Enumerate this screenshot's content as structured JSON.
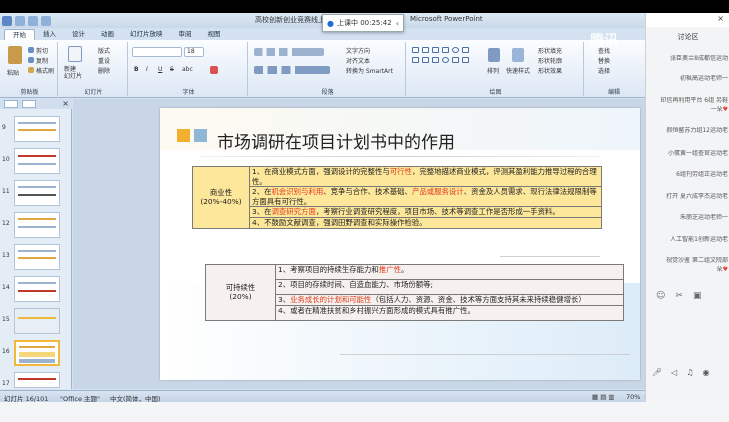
{
  "window": {
    "doc_title": "高校创新创业竞赛线上培",
    "app_name": "Microsoft PowerPoint",
    "timer": "上课中 00:25:42"
  },
  "tabs": [
    "开始",
    "插入",
    "设计",
    "动画",
    "幻灯片放映",
    "审阅",
    "视图"
  ],
  "ribbon": {
    "clipboard": {
      "paste": "粘贴",
      "cut": "剪切",
      "copy": "复制",
      "format_painter": "格式刷",
      "label": "剪贴板"
    },
    "slides": {
      "new_slide": "新建\n幻灯片",
      "layout": "版式",
      "reset": "重设",
      "delete": "删除",
      "label": "幻灯片"
    },
    "font": {
      "size": "18",
      "label": "字体",
      "bold": "B",
      "italic": "I",
      "underline": "U",
      "strike": "S",
      "shadow": "abc"
    },
    "paragraph": {
      "text_direction": "文字方向",
      "align_text": "对齐文本",
      "smartart": "转换为 SmartArt",
      "label": "段落"
    },
    "drawing": {
      "arrange": "排列",
      "quick_styles": "快速样式",
      "fill": "形状填充",
      "outline": "形状轮廓",
      "effects": "形状效果",
      "label": "绘图"
    },
    "editing": {
      "find": "查找",
      "replace": "替换",
      "select": "选择",
      "label": "编辑"
    }
  },
  "thumbnails": {
    "numbers": [
      "9",
      "10",
      "11",
      "12",
      "13",
      "14",
      "15",
      "16",
      "17"
    ],
    "selected": "16"
  },
  "slide": {
    "title": "市场调研在项目计划书中的作用",
    "table1": {
      "category_line1": "商业性",
      "category_line2": "(20%-40%)",
      "row1": {
        "a": "1、在商业模式方面，强调设计的完整性与",
        "b": "可行性",
        "c": "，完整地描述商业模式，评测其盈利能力推导过程的合理性。"
      },
      "row2": {
        "a": "2、在",
        "b": "机会识别与利用",
        "c": "、竞争与合作、技术基础、",
        "d": "产品或服务设计",
        "e": "、资金及人员需求、现行法律法规限制等方面具有可行性。"
      },
      "row3": {
        "a": "3、在",
        "b": "调查研究方面",
        "c": "，考察行业调查研究程度，项目市场、技术等调查工作是否形成一手资料。"
      },
      "row4": "4、不鼓励文献调查，强调田野调查和实际操作检验。"
    },
    "table2": {
      "category_line1": "可持续性",
      "category_line2": "(20%)",
      "row1": {
        "a": "1、考察项目的持续生存能力和",
        "b": "推广性",
        "c": "。"
      },
      "row2": "2、项目的存续时间、自造血能力、市场份额等;",
      "row3": {
        "a": "3、",
        "b": "业务成长的计划和可能性",
        "c": "（包括人力、资源、资金、技术等方面支持其未来持续稳健增长）"
      },
      "row4": "4、或者在精准扶贫和乡村振兴方面形成的模式具有推广性。"
    }
  },
  "statusbar": {
    "slide": "幻灯片 16/101",
    "theme": "\"Office 主题\"",
    "language": "中文(简体，中国)",
    "zoom": "70%"
  },
  "chat": {
    "title": "讨论区",
    "messages": [
      "张臣奥兰8成都信运动",
      "初枫高运动老师一",
      "印信再利用平台 6组 另鞋",
      "一朵",
      "郝恒鳌苏力组12运动老",
      "小蛋黄一组查官运动老",
      "6组刊劳组正运动老",
      "打开 夏六成李杰运动老",
      "朱丽芝运动老师一",
      "人工智能1创新运动老",
      "视觉沙鉴 第二组文院部",
      "朵"
    ],
    "heart_icon": "heart-icon"
  },
  "watermark": "腾讯"
}
